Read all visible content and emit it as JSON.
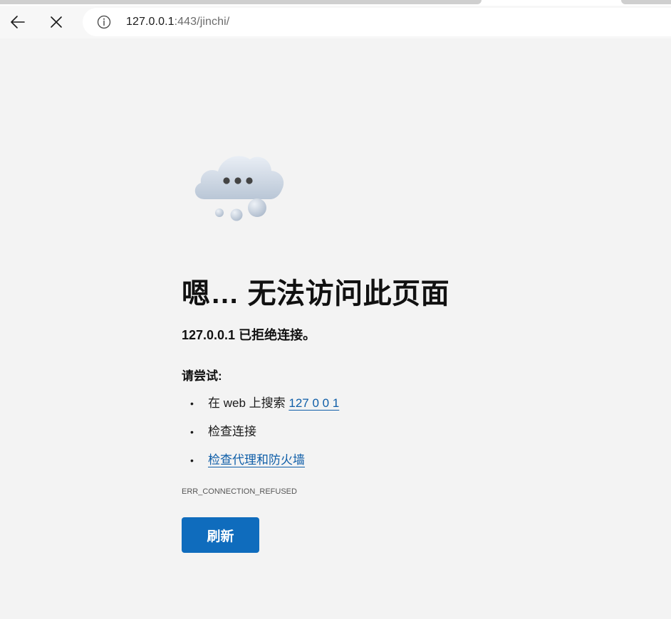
{
  "browser": {
    "back_icon": "arrow-left-icon",
    "stop_icon": "close-icon",
    "site_info_icon": "info-icon",
    "url_host": "127.0.0.1",
    "url_rest": ":443/jinchi/"
  },
  "error_page": {
    "illustration_icon": "cloud-ellipsis-icon",
    "headline": "嗯… 无法访问此页面",
    "subtitle": "127.0.0.1 已拒绝连接。",
    "try_label": "请尝试:",
    "suggestions": {
      "search_prefix": "在 web 上搜索 ",
      "search_link": "127 0 0 1",
      "check_connection": "检查连接",
      "check_proxy": "检查代理和防火墙"
    },
    "bullet": "•",
    "error_code": "ERR_CONNECTION_REFUSED",
    "refresh_label": "刷新"
  },
  "colors": {
    "page_background": "#f3f3f3",
    "link": "#0f5ea8",
    "primary_button": "#0f6cbd"
  }
}
